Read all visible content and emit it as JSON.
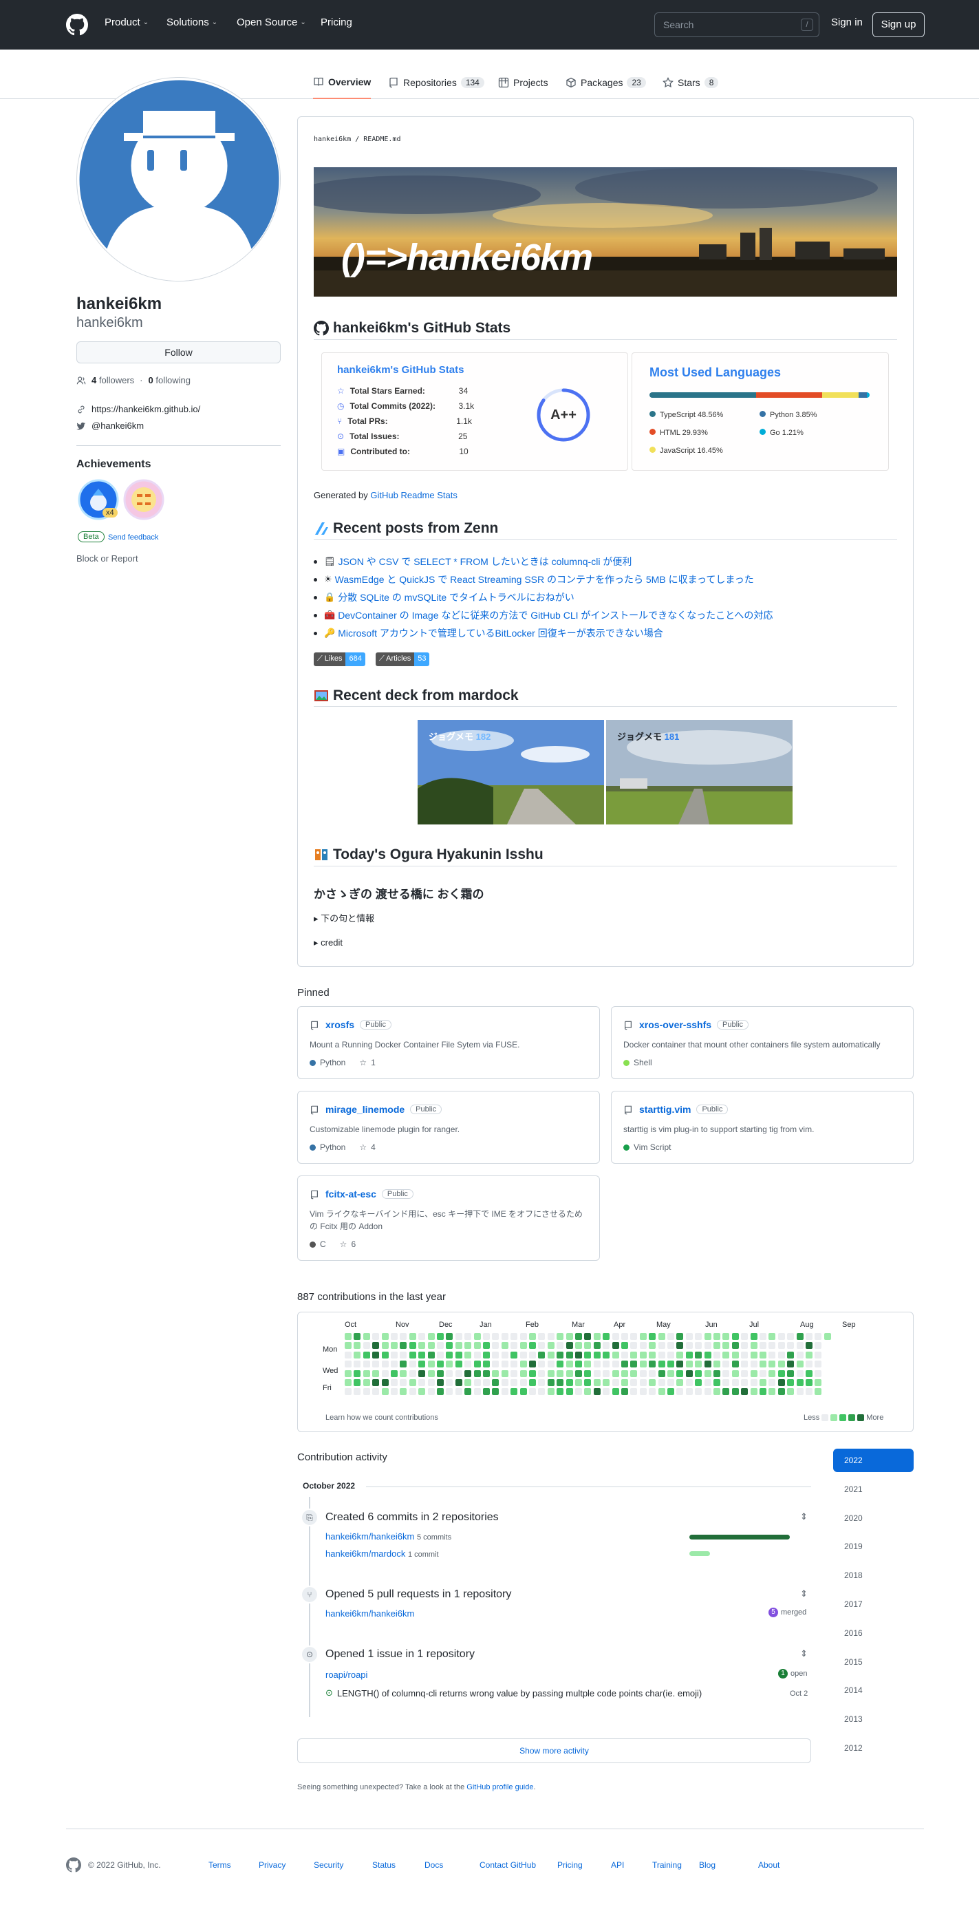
{
  "header": {
    "nav": [
      {
        "label": "Product",
        "has_menu": true
      },
      {
        "label": "Solutions",
        "has_menu": true
      },
      {
        "label": "Open Source",
        "has_menu": true
      },
      {
        "label": "Pricing",
        "has_menu": false
      }
    ],
    "search_placeholder": "Search",
    "search_shortcut": "/",
    "sign_in": "Sign in",
    "sign_up": "Sign up"
  },
  "tabs": [
    {
      "label": "Overview",
      "count": "",
      "icon": "book-icon",
      "selected": true
    },
    {
      "label": "Repositories",
      "count": "134",
      "icon": "repo-icon",
      "selected": false
    },
    {
      "label": "Projects",
      "count": "",
      "icon": "project-icon",
      "selected": false
    },
    {
      "label": "Packages",
      "count": "23",
      "icon": "package-icon",
      "selected": false
    },
    {
      "label": "Stars",
      "count": "8",
      "icon": "star-icon",
      "selected": false
    }
  ],
  "profile": {
    "name": "hankei6km",
    "login": "hankei6km",
    "follow_label": "Follow",
    "followers": "4",
    "followers_label": "followers",
    "following": "0",
    "following_label": "following",
    "website": "https://hankei6km.github.io/",
    "twitter": "@hankei6km",
    "achievements_title": "Achievements",
    "achievement_multiplier": "x4",
    "beta_label": "Beta",
    "feedback_label": "Send feedback",
    "block_label": "Block or Report"
  },
  "readme": {
    "breadcrumb_user": "hankei6km",
    "breadcrumb_sep": "/",
    "breadcrumb_file": "README.md",
    "banner_text": "()=>hankei6km",
    "stats_heading": "hankei6km's GitHub Stats",
    "stats_card": {
      "title": "hankei6km's GitHub Stats",
      "rows": [
        {
          "label": "Total Stars Earned:",
          "value": "34",
          "icon": "star-icon"
        },
        {
          "label": "Total Commits (2022):",
          "value": "3.1k",
          "icon": "clock-icon"
        },
        {
          "label": "Total PRs:",
          "value": "1.1k",
          "icon": "pull-request-icon"
        },
        {
          "label": "Total Issues:",
          "value": "25",
          "icon": "issue-icon"
        },
        {
          "label": "Contributed to:",
          "value": "10",
          "icon": "repo-icon"
        }
      ],
      "grade": "A++",
      "grade_progress_percent": 85
    },
    "languages_card": {
      "title": "Most Used Languages",
      "languages": [
        {
          "name": "TypeScript",
          "percent": "48.56%",
          "value": 48.56,
          "color": "#2b7489"
        },
        {
          "name": "Python",
          "percent": "3.85%",
          "value": 3.85,
          "color": "#3572A5"
        },
        {
          "name": "HTML",
          "percent": "29.93%",
          "value": 29.93,
          "color": "#e34c26"
        },
        {
          "name": "Go",
          "percent": "1.21%",
          "value": 1.21,
          "color": "#00ADD8"
        },
        {
          "name": "JavaScript",
          "percent": "16.45%",
          "value": 16.45,
          "color": "#f1e05a"
        }
      ]
    },
    "generated_by_prefix": "Generated by",
    "generated_by_link": "GitHub Readme Stats",
    "zenn_heading": "Recent posts from Zenn",
    "zenn_posts": [
      "JSON や CSV で SELECT * FROM したいときは columnq-cli が便利",
      "WasmEdge と QuickJS で React Streaming SSR のコンテナを作ったら 5MB に収まってしまった",
      "分散 SQLite の mvSQLite でタイムトラベルにおねがい",
      "DevContainer の Image などに従来の方法で GitHub CLI がインストールできなくなったことへの対応",
      "Microsoft アカウントで管理しているBitLocker 回復キーが表示できない場合"
    ],
    "zenn_badges": [
      {
        "label": "Likes",
        "value": "684"
      },
      {
        "label": "Articles",
        "value": "53"
      }
    ],
    "deck_heading": "Recent deck from mardock",
    "decks": [
      {
        "title": "ジョグメモ",
        "number": "182"
      },
      {
        "title": "ジョグメモ",
        "number": "181"
      }
    ],
    "ogura_heading": "Today's Ogura Hyakunin Isshu",
    "poem": "かさゝぎの 渡せる橋に おく霜の",
    "details": [
      "下の句と情報",
      "credit"
    ]
  },
  "pinned": {
    "title": "Pinned",
    "public_label": "Public",
    "repos": [
      {
        "name": "xrosfs",
        "desc": "Mount a Running Docker Container File Sytem via FUSE.",
        "lang": "Python",
        "color": "#3572A5",
        "stars": "1"
      },
      {
        "name": "xros-over-sshfs",
        "desc": "Docker container that mount other containers file system automatically",
        "lang": "Shell",
        "color": "#89e051",
        "stars": ""
      },
      {
        "name": "mirage_linemode",
        "desc": "Customizable linemode plugin for ranger.",
        "lang": "Python",
        "color": "#3572A5",
        "stars": "4"
      },
      {
        "name": "starttig.vim",
        "desc": "starttig is vim plug-in to support starting tig from vim.",
        "lang": "Vim Script",
        "color": "#199f4b",
        "stars": ""
      },
      {
        "name": "fcitx-at-esc",
        "desc": "Vim ライクなキーバインド用に、esc キー押下で IME をオフにさせるための Fcitx 用の Addon",
        "lang": "C",
        "color": "#555555",
        "stars": "6"
      }
    ]
  },
  "contributions": {
    "title": "887 contributions in the last year",
    "months": [
      "Oct",
      "Nov",
      "Dec",
      "Jan",
      "Feb",
      "Mar",
      "Apr",
      "May",
      "Jun",
      "Jul",
      "Aug",
      "Sep"
    ],
    "days": [
      "Mon",
      "Wed",
      "Fri"
    ],
    "learn_link": "Learn how we count contributions",
    "less": "Less",
    "more": "More"
  },
  "activity": {
    "title": "Contribution activity",
    "month": "October 2022",
    "years": [
      "2022",
      "2021",
      "2020",
      "2019",
      "2018",
      "2017",
      "2016",
      "2015",
      "2014",
      "2013",
      "2012"
    ],
    "commits": {
      "title": "Created 6 commits in 2 repositories",
      "repos": [
        {
          "name": "hankei6km/hankei6km",
          "count": "5 commits",
          "ratio": 0.83
        },
        {
          "name": "hankei6km/mardock",
          "count": "1 commit",
          "ratio": 0.17
        }
      ]
    },
    "prs": {
      "title": "Opened 5 pull requests in 1 repository",
      "repo": "hankei6km/hankei6km",
      "merged_count": "5",
      "merged_label": "merged"
    },
    "issues": {
      "title": "Opened 1 issue in 1 repository",
      "repo": "roapi/roapi",
      "open_count": "1",
      "open_label": "open",
      "issue_title": "LENGTH() of columnq-cli returns wrong value by passing multple code points char(ie. emoji)",
      "issue_date": "Oct 2"
    },
    "show_more": "Show more activity",
    "unexpected_prefix": "Seeing something unexpected? Take a look at the",
    "unexpected_link": "GitHub profile guide",
    "unexpected_suffix": "."
  },
  "footer": {
    "copyright": "© 2022 GitHub, Inc.",
    "links": [
      "Terms",
      "Privacy",
      "Security",
      "Status",
      "Docs",
      "Contact GitHub",
      "Pricing",
      "API",
      "Training",
      "Blog",
      "About"
    ]
  }
}
